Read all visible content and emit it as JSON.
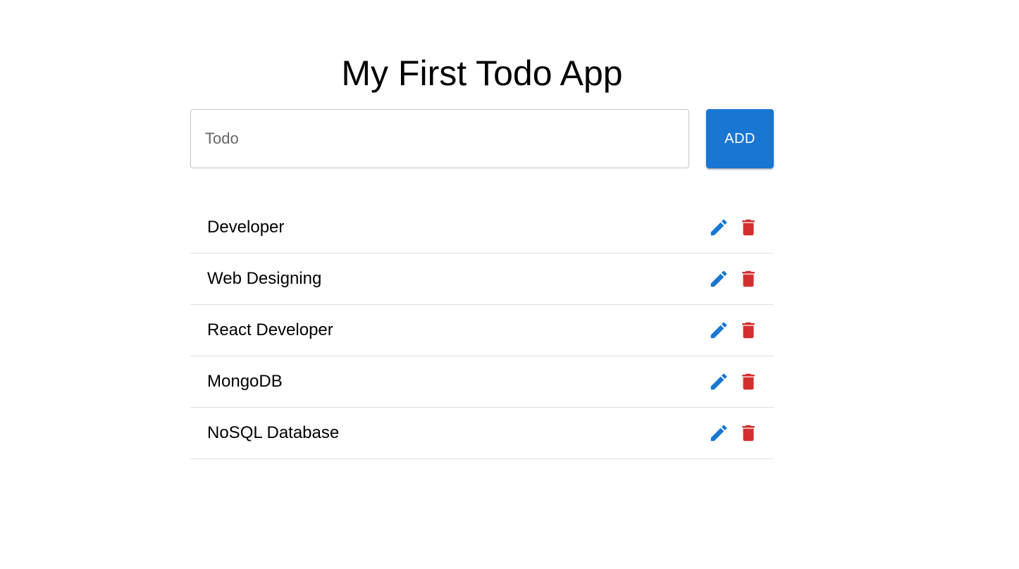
{
  "header": {
    "title": "My First Todo App"
  },
  "form": {
    "input_placeholder": "Todo",
    "input_value": "",
    "add_label": "ADD"
  },
  "todos": [
    {
      "text": "Developer"
    },
    {
      "text": "Web Designing"
    },
    {
      "text": "React Developer"
    },
    {
      "text": "MongoDB"
    },
    {
      "text": "NoSQL Database"
    }
  ],
  "icons": {
    "edit": "edit-icon",
    "delete": "delete-icon"
  },
  "colors": {
    "primary": "#1976d2",
    "danger": "#d32f2f"
  }
}
